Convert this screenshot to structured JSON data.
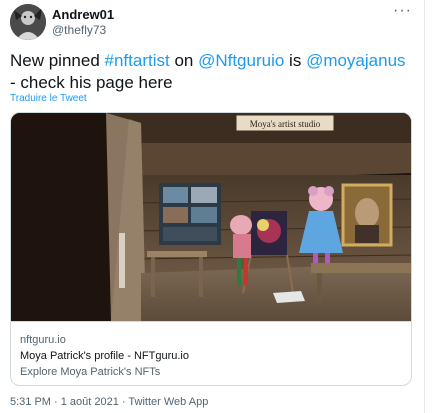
{
  "user": {
    "display_name": "Andrew01",
    "handle": "@thefly73"
  },
  "tweet": {
    "text_part1": "New pinned ",
    "hashtag": "#nftartist",
    "text_part2": " on ",
    "mention1": "@Nftguruio",
    "text_part3": " is ",
    "mention2": "@moyajanus",
    "text_part4": " - check his page here",
    "translate_label": "Traduire le Tweet",
    "more_label": "···"
  },
  "card": {
    "image_sign_text": "Moya's artist studio",
    "domain": "nftguru.io",
    "title": "Moya Patrick's profile - NFTguru.io",
    "description": "Explore Moya Patrick's NFTs"
  },
  "meta": {
    "timestamp": "5:31 PM · 1 août 2021 · Twitter Web App"
  },
  "colors": {
    "link": "#1d9bf0",
    "text": "#0f1419",
    "secondary": "#536471",
    "border": "#cfd9de"
  }
}
